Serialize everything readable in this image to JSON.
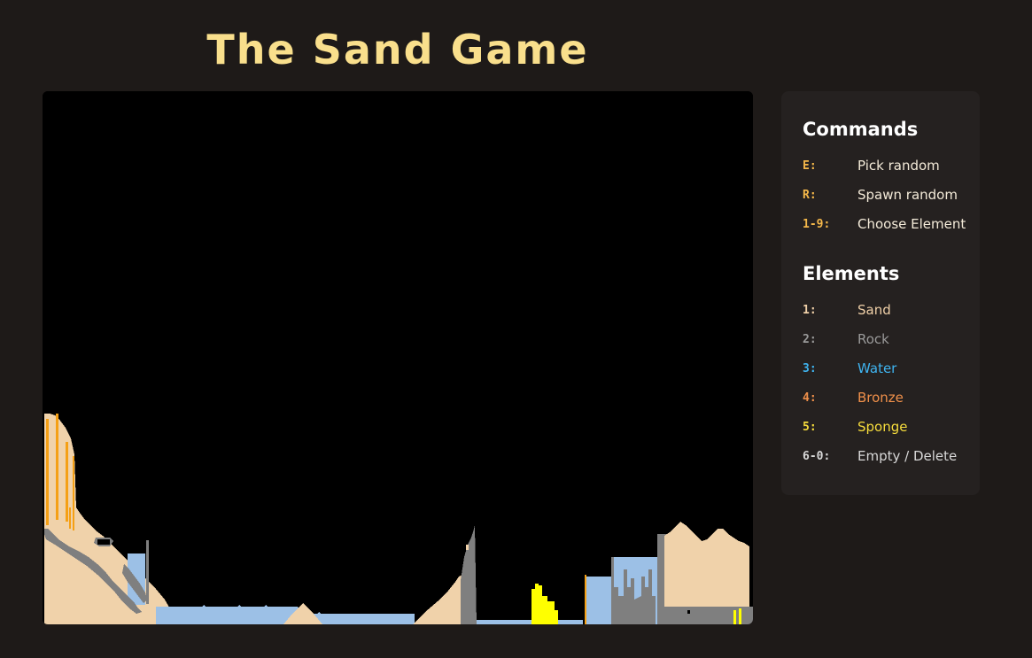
{
  "title": "The Sand Game",
  "commands": {
    "heading": "Commands",
    "items": [
      {
        "key": "E:",
        "label": "Pick random"
      },
      {
        "key": "R:",
        "label": "Spawn random"
      },
      {
        "key": "1-9:",
        "label": "Choose Element"
      }
    ]
  },
  "elements": {
    "heading": "Elements",
    "items": [
      {
        "key": "1:",
        "label": "Sand",
        "color": "#f0d0a8",
        "key_color": "#f0d0a8"
      },
      {
        "key": "2:",
        "label": "Rock",
        "color": "#9a9a9a",
        "key_color": "#9a9a9a"
      },
      {
        "key": "3:",
        "label": "Water",
        "color": "#3fb4f0",
        "key_color": "#3fb4f0"
      },
      {
        "key": "4:",
        "label": "Bronze",
        "color": "#f0904a",
        "key_color": "#f0904a"
      },
      {
        "key": "5:",
        "label": "Sponge",
        "color": "#f6dc3c",
        "key_color": "#f6dc3c"
      },
      {
        "key": "6-0:",
        "label": "Empty / Delete",
        "color": "#d8d8d8",
        "key_color": "#d8d8d8"
      }
    ]
  },
  "colors": {
    "title": "#f9df8c",
    "background": "#1e1a18",
    "canvas": "#000000",
    "sand": "#f0d2aa",
    "rock": "#7f7f7f",
    "water": "#9cc0e6",
    "bronze": "#f5a015",
    "sponge": "#ffff00"
  }
}
